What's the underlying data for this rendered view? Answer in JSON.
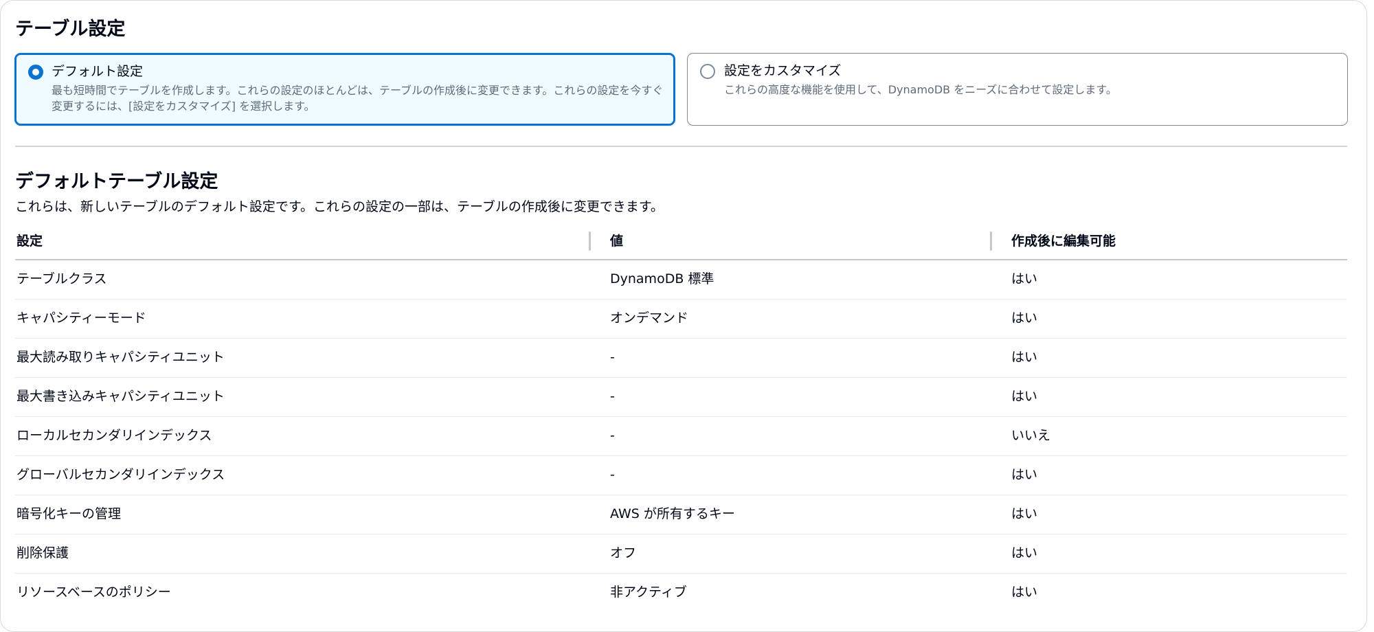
{
  "table_settings": {
    "title": "テーブル設定",
    "options": [
      {
        "label": "デフォルト設定",
        "description": "最も短時間でテーブルを作成します。これらの設定のほとんどは、テーブルの作成後に変更できます。これらの設定を今すぐ変更するには、[設定をカスタマイズ] を選択します。",
        "selected": true
      },
      {
        "label": "設定をカスタマイズ",
        "description": "これらの高度な機能を使用して、DynamoDB をニーズに合わせて設定します。",
        "selected": false
      }
    ]
  },
  "default_table_settings": {
    "title": "デフォルトテーブル設定",
    "description": "これらは、新しいテーブルのデフォルト設定です。これらの設定の一部は、テーブルの作成後に変更できます。",
    "columns": [
      "設定",
      "値",
      "作成後に編集可能"
    ],
    "rows": [
      {
        "setting": "テーブルクラス",
        "value": "DynamoDB 標準",
        "editable": "はい"
      },
      {
        "setting": "キャパシティーモード",
        "value": "オンデマンド",
        "editable": "はい"
      },
      {
        "setting": "最大読み取りキャパシティユニット",
        "value": "-",
        "editable": "はい"
      },
      {
        "setting": "最大書き込みキャパシティユニット",
        "value": "-",
        "editable": "はい"
      },
      {
        "setting": "ローカルセカンダリインデックス",
        "value": "-",
        "editable": "いいえ"
      },
      {
        "setting": "グローバルセカンダリインデックス",
        "value": "-",
        "editable": "はい"
      },
      {
        "setting": "暗号化キーの管理",
        "value": "AWS が所有するキー",
        "editable": "はい"
      },
      {
        "setting": "削除保護",
        "value": "オフ",
        "editable": "はい"
      },
      {
        "setting": "リソースベースのポリシー",
        "value": "非アクティブ",
        "editable": "はい"
      }
    ]
  },
  "colors": {
    "accent": "#0972d3",
    "selected_tile_bg": "#f0fbff",
    "text_primary": "#000716",
    "text_secondary": "#5f6b7a",
    "border": "#7d8998"
  }
}
